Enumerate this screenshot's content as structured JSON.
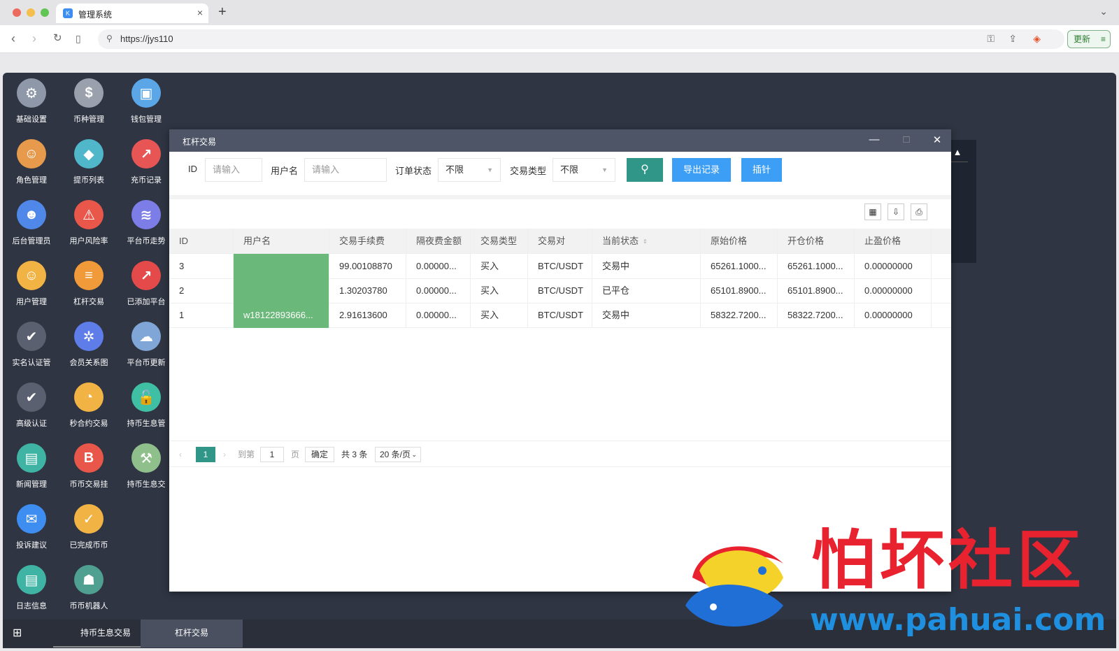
{
  "browser": {
    "tab_title": "管理系统",
    "tab_favicon": "K",
    "url": "https://jys110",
    "update_label": "更新"
  },
  "desktop_icons": [
    {
      "label": "基础设置",
      "icon": "gear-icon",
      "color": "#8e98a8",
      "glyph": "⚙"
    },
    {
      "label": "币种管理",
      "icon": "dollar-icon",
      "color": "#9aa1ac",
      "glyph": "$"
    },
    {
      "label": "钱包管理",
      "icon": "wallet-icon",
      "color": "#5aa6e6",
      "glyph": "▣"
    },
    {
      "label": "角色管理",
      "icon": "roles-icon",
      "color": "#e79a4c",
      "glyph": "☺"
    },
    {
      "label": "提币列表",
      "icon": "withdraw-icon",
      "color": "#4fb7c9",
      "glyph": "◆"
    },
    {
      "label": "充币记录",
      "icon": "deposit-icon",
      "color": "#e85555",
      "glyph": "↗"
    },
    {
      "label": "后台管理员",
      "icon": "admin-icon",
      "color": "#4f88e8",
      "glyph": "☻"
    },
    {
      "label": "用户风险率",
      "icon": "alarm-icon",
      "color": "#e8574a",
      "glyph": "⚠"
    },
    {
      "label": "平台币走势",
      "icon": "layers-icon",
      "color": "#7d7de8",
      "glyph": "≋"
    },
    {
      "label": "用户管理",
      "icon": "user-search-icon",
      "color": "#f2b345",
      "glyph": "☺"
    },
    {
      "label": "杠杆交易",
      "icon": "stack-icon",
      "color": "#f09a3a",
      "glyph": "≡"
    },
    {
      "label": "已添加平台",
      "icon": "trend-icon",
      "color": "#e54a4a",
      "glyph": "↗"
    },
    {
      "label": "实名认证管",
      "icon": "id-verify-icon",
      "color": "#5a6070",
      "glyph": "✔"
    },
    {
      "label": "会员关系图",
      "icon": "network-icon",
      "color": "#5f7de8",
      "glyph": "✲"
    },
    {
      "label": "平台币更新",
      "icon": "cloud-refresh-icon",
      "color": "#7fa6d6",
      "glyph": "☁"
    },
    {
      "label": "高级认证",
      "icon": "advanced-verify-icon",
      "color": "#5a6070",
      "glyph": "✔"
    },
    {
      "label": "秒合约交易",
      "icon": "stopwatch-icon",
      "color": "#f2b345",
      "glyph": "◔"
    },
    {
      "label": "持币生息管",
      "icon": "unlock-icon",
      "color": "#3fbfa4",
      "glyph": "🔓"
    },
    {
      "label": "新闻管理",
      "icon": "news-icon",
      "color": "#3fb4a4",
      "glyph": "▤"
    },
    {
      "label": "币币交易挂",
      "icon": "coin-b-icon",
      "color": "#e8574a",
      "glyph": "B"
    },
    {
      "label": "持币生息交",
      "icon": "hammer-icon",
      "color": "#8fbf8a",
      "glyph": "⚒"
    },
    {
      "label": "投诉建议",
      "icon": "mail-icon",
      "color": "#3d8ef0",
      "glyph": "✉"
    },
    {
      "label": "已完成币币",
      "icon": "check-box-icon",
      "color": "#f2b345",
      "glyph": "✓"
    },
    {
      "label": "",
      "icon": "",
      "color": "",
      "glyph": ""
    },
    {
      "label": "日志信息",
      "icon": "log-icon",
      "color": "#3fb4a4",
      "glyph": "▤"
    },
    {
      "label": "币币机器人",
      "icon": "robot-icon",
      "color": "#4fa090",
      "glyph": "☗"
    }
  ],
  "window": {
    "title": "杠杆交易",
    "filters": {
      "id_label": "ID",
      "id_placeholder": "请输入",
      "username_label": "用户名",
      "username_placeholder": "请输入",
      "order_status_label": "订单状态",
      "order_status_value": "不限",
      "trade_type_label": "交易类型",
      "trade_type_value": "不限",
      "export_label": "导出记录",
      "pin_label": "插针"
    },
    "table": {
      "columns": [
        "ID",
        "用户名",
        "交易手续费",
        "隔夜费金额",
        "交易类型",
        "交易对",
        "当前状态",
        "原始价格",
        "开仓价格",
        "止盈价格"
      ],
      "rows": [
        [
          "3",
          "",
          "99.00108870",
          "0.00000...",
          "买入",
          "BTC/USDT",
          "交易中",
          "65261.1000...",
          "65261.1000...",
          "0.00000000"
        ],
        [
          "2",
          "",
          "1.30203780",
          "0.00000...",
          "买入",
          "BTC/USDT",
          "已平仓",
          "65101.8900...",
          "65101.8900...",
          "0.00000000"
        ],
        [
          "1",
          "w18122893666...",
          "2.91613600",
          "0.00000...",
          "买入",
          "BTC/USDT",
          "交易中",
          "58322.7200...",
          "58322.7200...",
          "0.00000000"
        ]
      ]
    },
    "pager": {
      "current_page": "1",
      "goto_label": "到第",
      "goto_value": "1",
      "page_unit": "页",
      "confirm_label": "确定",
      "total_label": "共 3 条",
      "page_size": "20 条/页"
    }
  },
  "taskbar": {
    "tasks": [
      "持币生息交易",
      "杠杆交易"
    ]
  },
  "watermark": {
    "title": "怕坏社区",
    "url": "www.pahuai.com"
  },
  "colors": {
    "primary": "#309688",
    "blue": "#3d9ef5",
    "desktop_bg": "#2f3542",
    "username_highlight": "#6ab87a"
  }
}
